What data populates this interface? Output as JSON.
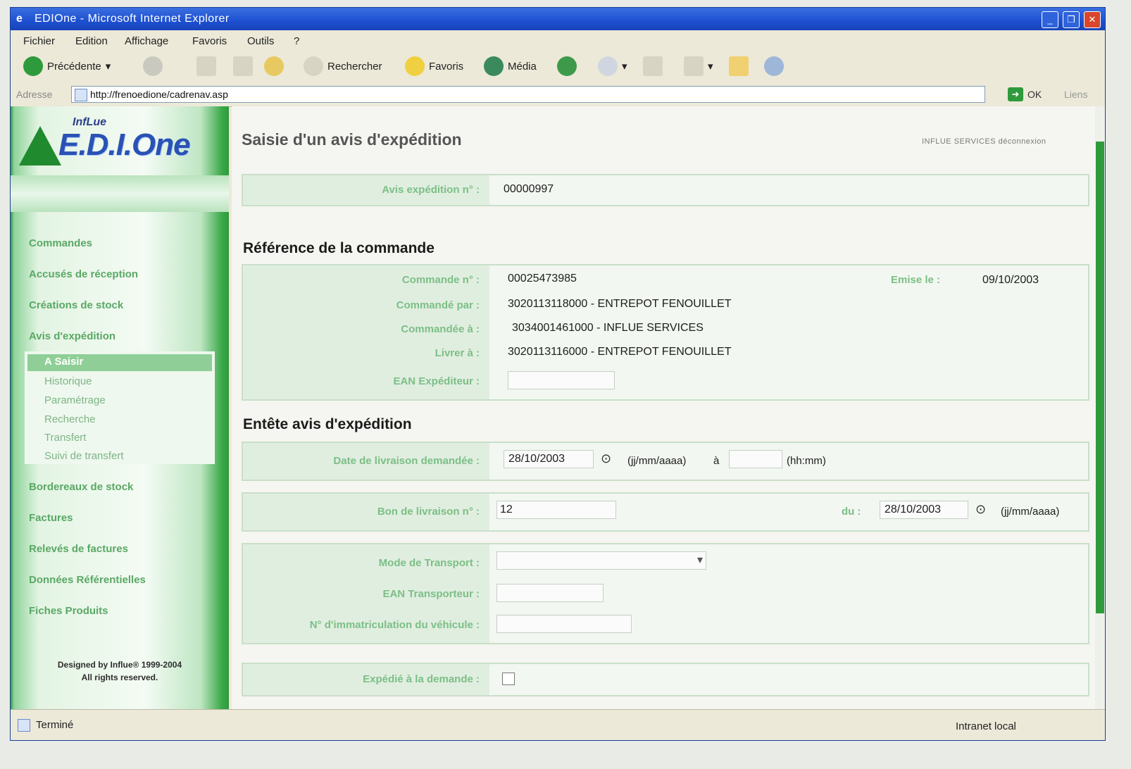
{
  "window": {
    "title": "EDIOne - Microsoft Internet Explorer",
    "controls": [
      "_",
      "❐",
      "✕"
    ]
  },
  "menu": [
    "Fichier",
    "Edition",
    "Affichage",
    "Favoris",
    "Outils",
    "?"
  ],
  "toolbar": {
    "back_label": "Précédente",
    "search_label": "Rechercher",
    "favorites_label": "Favoris",
    "media_label": "Média"
  },
  "address": {
    "label": "Adresse",
    "url": "http://frenoedione/cadrenav.asp",
    "go_label": "OK",
    "links_label": "Liens"
  },
  "logo": {
    "tag": "InfLue",
    "word": "E.D.I.One"
  },
  "sidebar": {
    "items": [
      "Commandes",
      "Accusés de réception",
      "Créations de stock",
      "Avis d'expédition"
    ],
    "submenu": [
      "A Saisir",
      "Historique",
      "Paramétrage",
      "Recherche",
      "Transfert",
      "Suivi de transfert"
    ],
    "items_after": [
      "Bordereaux de stock",
      "Factures",
      "Relevés de factures",
      "Données Référentielles",
      "Fiches Produits"
    ],
    "copyright_line1": "Designed by Influe® 1999-2004",
    "copyright_line2": "All rights reserved."
  },
  "content": {
    "title": "Saisie d'un avis d'expédition",
    "topright": "INFLUE SERVICES déconnexion",
    "avis": {
      "label": "Avis expédition n° :",
      "value": "00000997"
    },
    "ref_section": "Référence de la commande",
    "ref": {
      "cmd_label": "Commande n° :",
      "cmd_value": "00025473985",
      "emise_label": "Emise le :",
      "emise_value": "09/10/2003",
      "par_label": "Commandé par :",
      "par_value": "3020113118000 - ENTREPOT FENOUILLET",
      "a_label": "Commandée à :",
      "a_value": "3034001461000 - INFLUE SERVICES",
      "livrer_label": "Livrer à :",
      "livrer_value": "3020113116000 - ENTREPOT FENOUILLET",
      "ean_label": "EAN Expéditeur :"
    },
    "entete_section": "Entête avis d'expédition",
    "date_liv": {
      "label": "Date de livraison demandée :",
      "value": "28/10/2003",
      "fmt_date": "(jj/mm/aaaa)",
      "a": "à",
      "fmt_time": "(hh:mm)"
    },
    "bon": {
      "label": "Bon de livraison n° :",
      "value": "12",
      "du": "du :",
      "date": "28/10/2003",
      "fmt": "(jj/mm/aaaa)"
    },
    "transport": {
      "mode_label": "Mode de Transport :",
      "ean_label": "EAN Transporteur :",
      "immat_label": "N° d'immatriculation du véhicule :"
    },
    "expedie": {
      "label": "Expédié à la demande :"
    }
  },
  "status": {
    "text": "Terminé",
    "zone": "Intranet local"
  },
  "colors": {
    "sidebar_green": "#2e9a3c",
    "label_green": "#7cbf86",
    "titlebar_blue": "#1d4fd0"
  }
}
